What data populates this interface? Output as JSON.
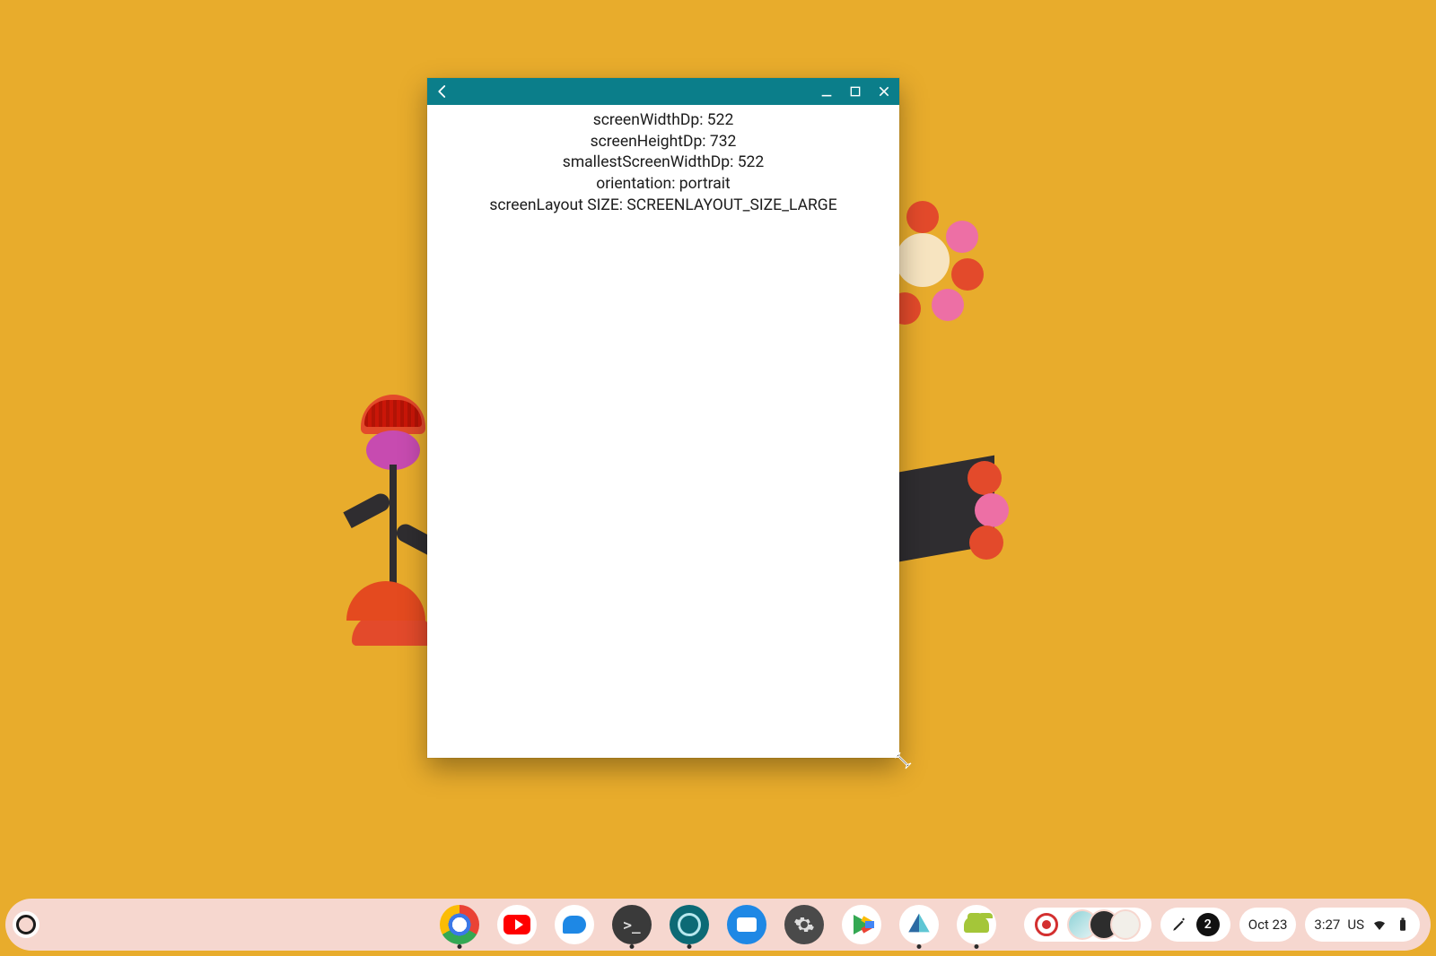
{
  "window": {
    "titlebar_color": "#0b7e8a",
    "content": {
      "lines": [
        {
          "label": "screenWidthDp",
          "value": "522"
        },
        {
          "label": "screenHeightDp",
          "value": "732"
        },
        {
          "label": "smallestScreenWidthDp",
          "value": "522"
        },
        {
          "label": "orientation",
          "value": "portrait"
        },
        {
          "label": "screenLayout SIZE",
          "value": "SCREENLAYOUT_SIZE_LARGE"
        }
      ]
    }
  },
  "shelf": {
    "apps": [
      {
        "name": "chrome",
        "running": true
      },
      {
        "name": "youtube",
        "running": false
      },
      {
        "name": "messages",
        "running": false
      },
      {
        "name": "terminal",
        "running": true
      },
      {
        "name": "teal-app",
        "running": true
      },
      {
        "name": "files",
        "running": false
      },
      {
        "name": "settings",
        "running": false
      },
      {
        "name": "play-store",
        "running": false
      },
      {
        "name": "android-studio",
        "running": true
      },
      {
        "name": "android-emulator",
        "running": true
      }
    ],
    "tray": {
      "notification_count": "2",
      "date": "Oct 23",
      "time": "3:27",
      "keyboard": "US"
    }
  }
}
